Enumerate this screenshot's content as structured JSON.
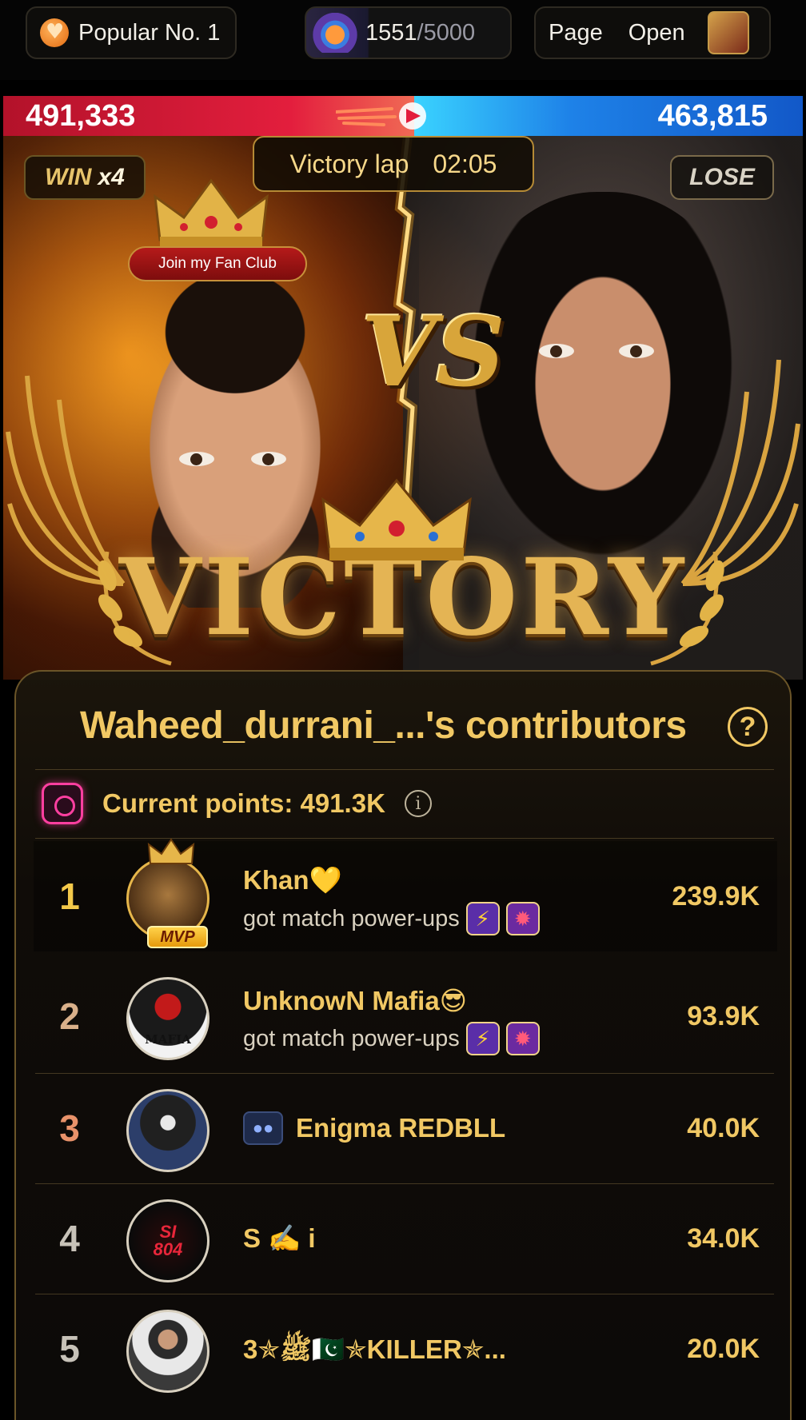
{
  "topbar": {
    "popular_label": "Popular No. 1",
    "gauge_current": "1551",
    "gauge_separator": "/",
    "gauge_max": "5000",
    "page_label": "Page",
    "open_label": "Open"
  },
  "battle": {
    "left_score": "491,333",
    "right_score": "463,815",
    "left_share": 0.514,
    "win_label": "WIN",
    "win_multiplier": "x4",
    "lose_label": "LOSE",
    "victory_lap_label": "Victory lap",
    "timer": "02:05",
    "fan_club_button": "Join my Fan Club",
    "vs_text": "VS",
    "result_title": "VICTORY",
    "colors": {
      "red_team": "#e31e3d",
      "blue_team": "#1e82e8",
      "gold": "#f1c864"
    }
  },
  "contributors": {
    "title": "Waheed_durrani_...'s contributors",
    "help_symbol": "?",
    "points_label": "Current points: 491.3K",
    "info_symbol": "i",
    "rows": [
      {
        "rank": "1",
        "name": "Khan💛",
        "subtitle": "got match power-ups",
        "score": "239.9K",
        "badge": "MVP",
        "avatar_icon": "lion-avatar-icon",
        "power_ups": [
          "⚡",
          "✹"
        ]
      },
      {
        "rank": "2",
        "name": "UnknowN Mafia😎",
        "subtitle": "got match power-ups",
        "score": "93.9K",
        "avatar_text": "MAFIA",
        "avatar_icon": "mafia-avatar-icon",
        "power_ups": [
          "⚡",
          "✹"
        ]
      },
      {
        "rank": "3",
        "name": "Enigma REDBLL",
        "score": "40.0K",
        "avatar_icon": "hooded-figure-avatar-icon"
      },
      {
        "rank": "4",
        "name": "S ✍️ i",
        "score": "34.0K",
        "avatar_text": "SI 804",
        "avatar_icon": "si-logo-avatar-icon"
      },
      {
        "rank": "5",
        "name": "ﷺ✯3🇵🇰✯KILLER✯...",
        "score": "20.0K",
        "avatar_icon": "man-photo-avatar-icon"
      }
    ],
    "rank_colors": [
      "#f3c84a",
      "#d9b08a",
      "#e8926a",
      "#c7c2b8",
      "#c7c2b8"
    ]
  }
}
